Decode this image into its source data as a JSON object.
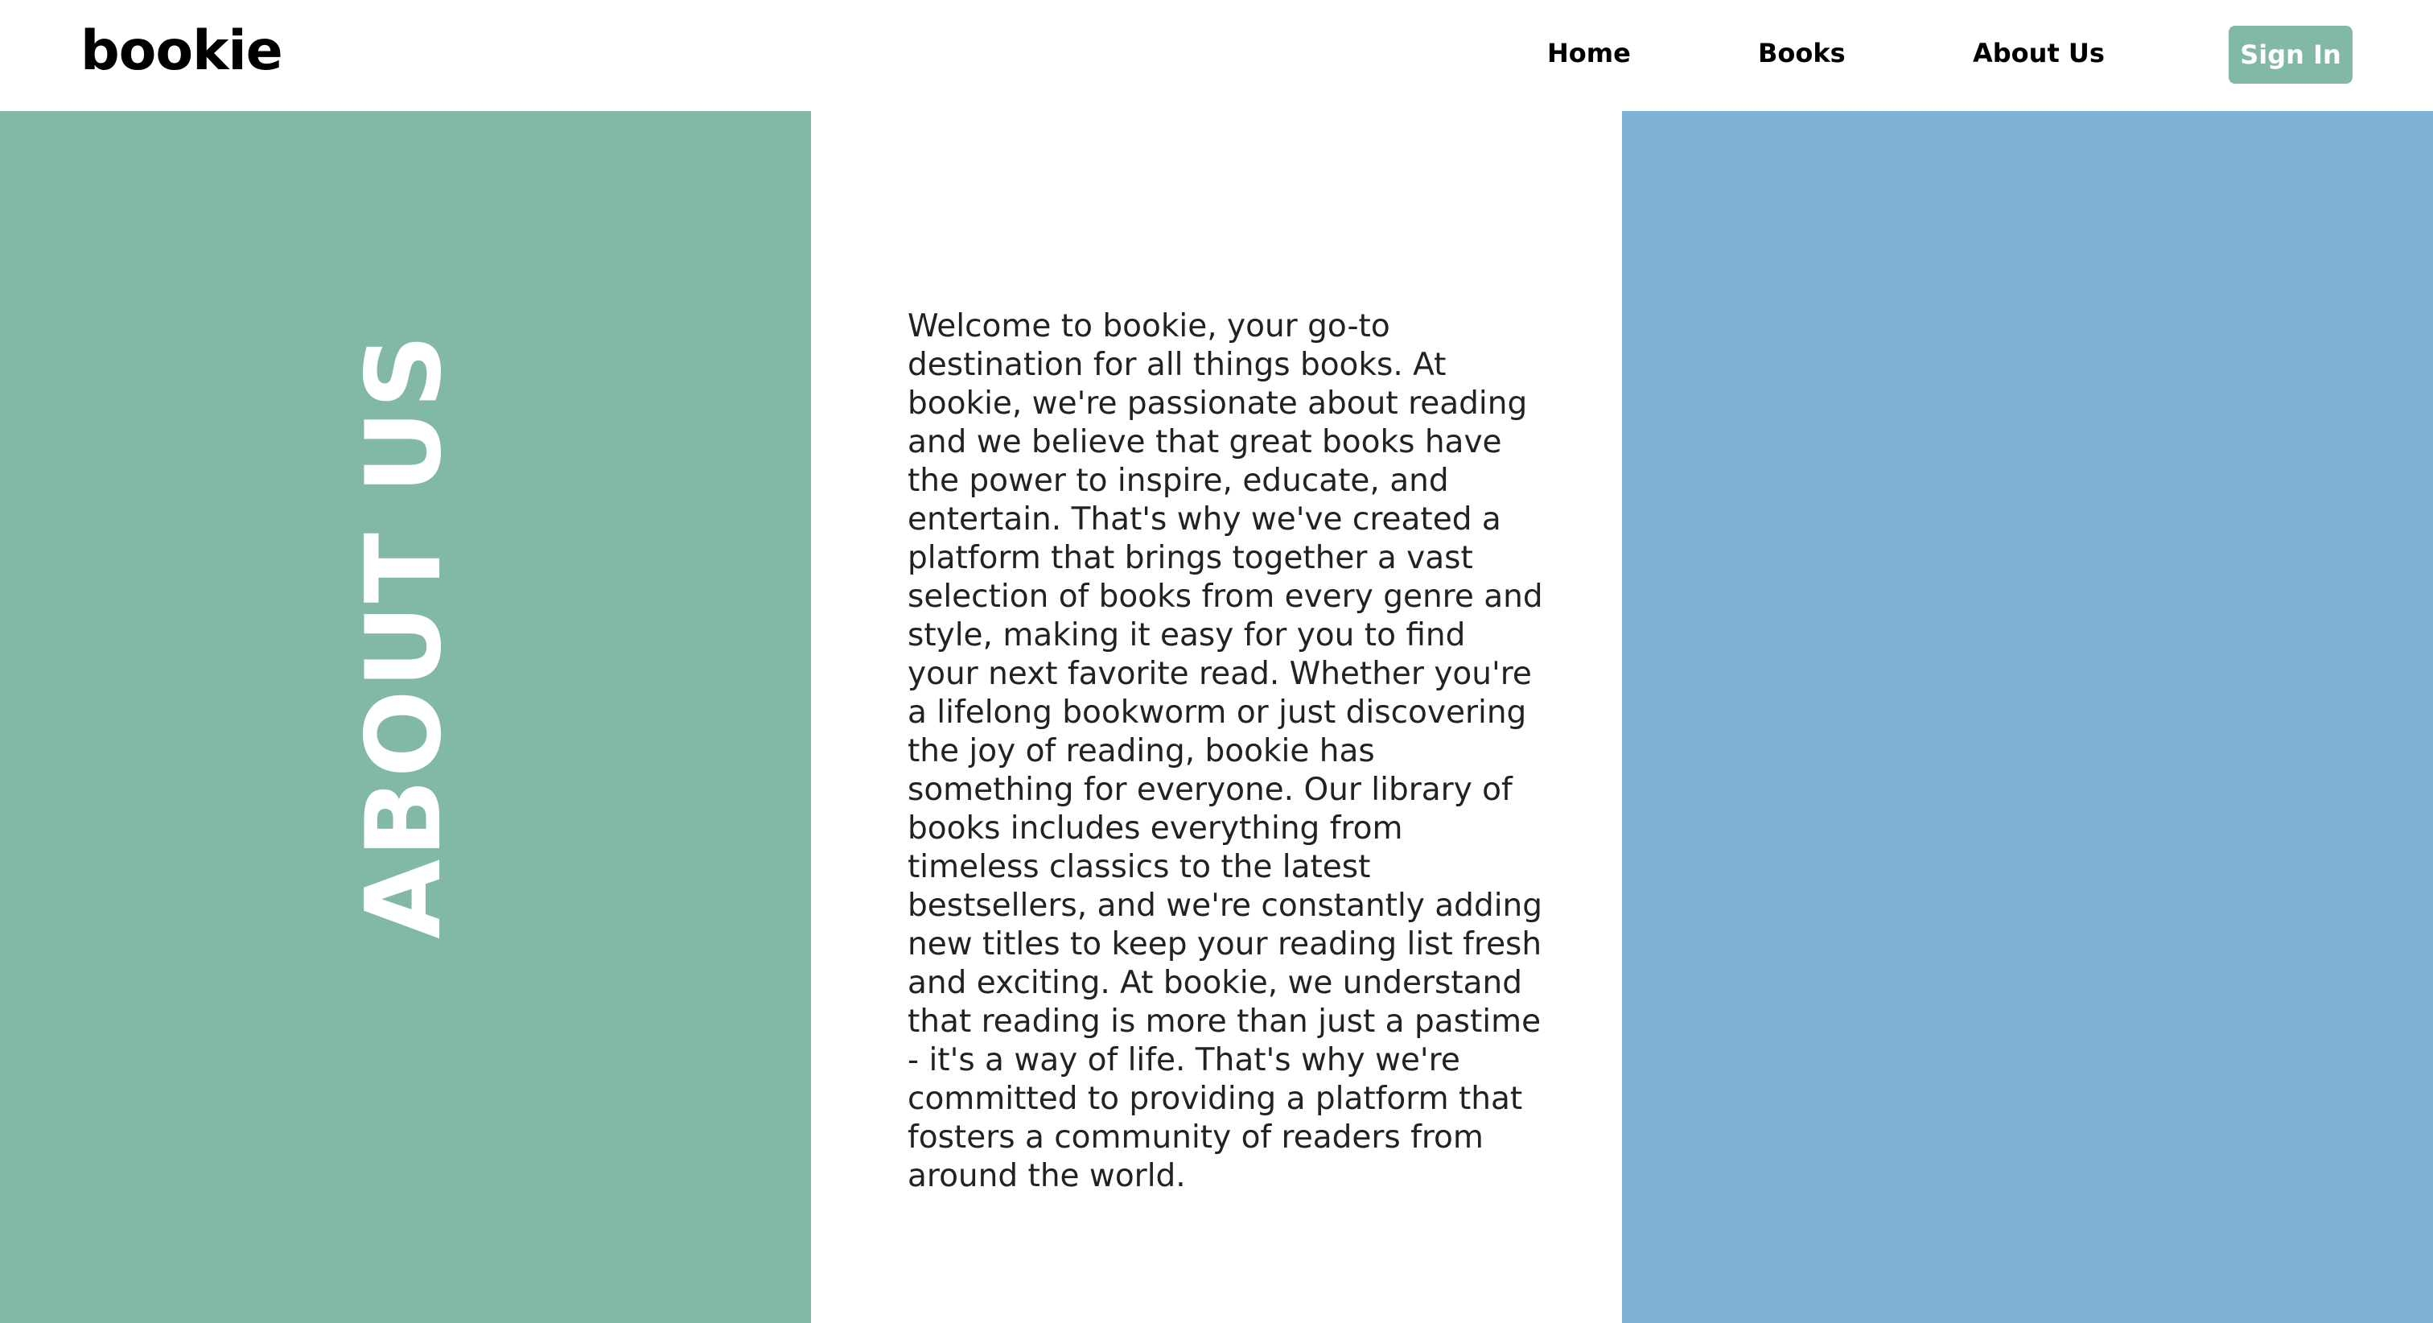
{
  "header": {
    "logo": "bookie",
    "nav": {
      "home": "Home",
      "books": "Books",
      "about": "About Us"
    },
    "signin_label": "Sign In"
  },
  "main": {
    "vertical_title": "ABOUT US",
    "about_text": "Welcome to bookie, your go-to destination for all things books. At bookie, we're passionate about reading and we believe that great books have the power to inspire, educate, and entertain. That's why we've created a platform that brings together a vast selection of books from every genre and style, making it easy for you to find your next favorite read. Whether you're a lifelong bookworm or just discovering the joy of reading, bookie has something for everyone. Our library of books includes everything from timeless classics to the latest bestsellers, and we're constantly adding new titles to keep your reading list fresh and exciting. At bookie, we understand that reading is more than just a pastime - it's a way of life. That's why we're committed to providing a platform that fosters a community of readers from around the world."
  },
  "colors": {
    "green_panel": "#82b9a6",
    "blue_panel": "#7eb2d6",
    "signin_button": "#82b9a6"
  }
}
